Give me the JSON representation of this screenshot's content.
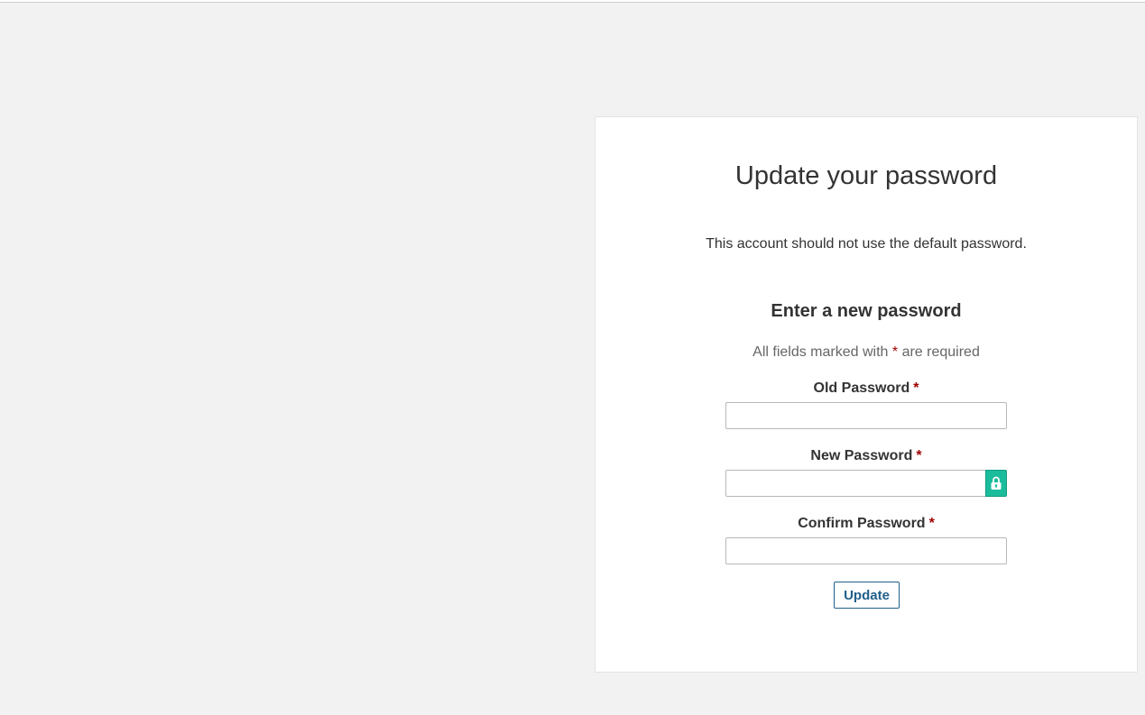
{
  "card": {
    "title": "Update your password",
    "warning": "This account should not use the default password.",
    "subtitle": "Enter a new password",
    "required_note_prefix": "All fields marked with",
    "required_note_asterisk": "*",
    "required_note_suffix": "are required"
  },
  "fields": {
    "old_password": {
      "label": "Old Password",
      "asterisk": "*",
      "value": ""
    },
    "new_password": {
      "label": "New Password",
      "asterisk": "*",
      "value": "",
      "addon_icon": "lock-icon"
    },
    "confirm_password": {
      "label": "Confirm Password",
      "asterisk": "*",
      "value": ""
    }
  },
  "actions": {
    "update_label": "Update"
  },
  "colors": {
    "background": "#f2f2f2",
    "card": "#ffffff",
    "asterisk": "#a00000",
    "lock_addon": "#1abc9c",
    "button_accent": "#1f5f8a"
  }
}
